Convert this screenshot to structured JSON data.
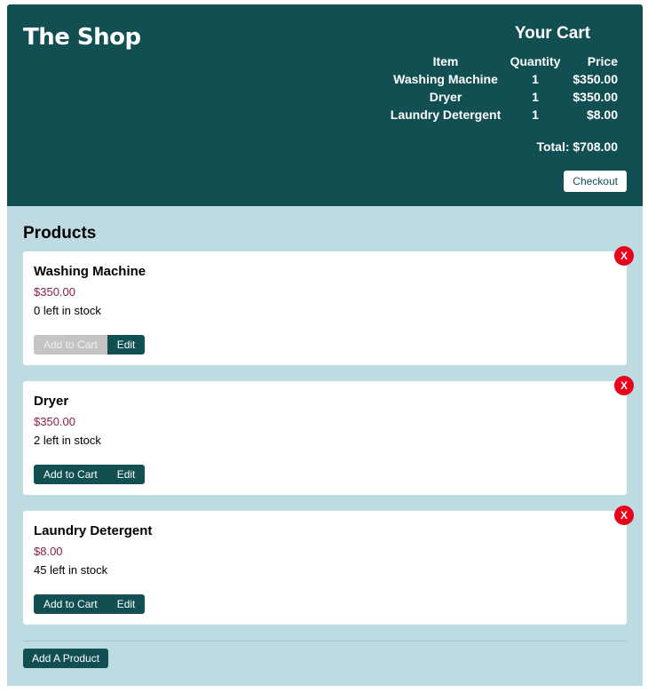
{
  "header": {
    "logo": "The Shop",
    "cart": {
      "title": "Your Cart",
      "columns": [
        "Item",
        "Quantity",
        "Price"
      ],
      "rows": [
        {
          "item": "Washing Machine",
          "quantity": "1",
          "price": "$350.00"
        },
        {
          "item": "Dryer",
          "quantity": "1",
          "price": "$350.00"
        },
        {
          "item": "Laundry Detergent",
          "quantity": "1",
          "price": "$8.00"
        }
      ],
      "total": "Total: $708.00",
      "checkout_label": "Checkout"
    }
  },
  "main": {
    "title": "Products",
    "products": [
      {
        "name": "Washing Machine",
        "price": "$350.00",
        "stock": "0 left in stock",
        "add_label": "Add to Cart",
        "edit_label": "Edit",
        "delete_label": "X"
      },
      {
        "name": "Dryer",
        "price": "$350.00",
        "stock": "2 left in stock",
        "add_label": "Add to Cart",
        "edit_label": "Edit",
        "delete_label": "X"
      },
      {
        "name": "Laundry Detergent",
        "price": "$8.00",
        "stock": "45 left in stock",
        "add_label": "Add to Cart",
        "edit_label": "Edit",
        "delete_label": "X"
      }
    ],
    "add_product_label": "Add A Product"
  },
  "colors": {
    "header_bg": "#124f52",
    "main_bg": "#bddbe1",
    "price": "#8b1e3f",
    "delete": "#e8001c",
    "disabled": "#c4c4c4"
  }
}
